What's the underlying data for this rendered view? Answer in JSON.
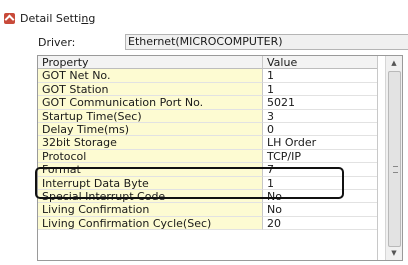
{
  "title": {
    "text_pre": "Detail Setti",
    "text_ul": "n",
    "text_post": "g"
  },
  "driver": {
    "label": "Driver:",
    "value": "Ethernet(MICROCOMPUTER)"
  },
  "grid": {
    "header": {
      "property": "Property",
      "value": "Value"
    },
    "rows": [
      {
        "property": "GOT Net No.",
        "value": "1"
      },
      {
        "property": "GOT Station",
        "value": "1"
      },
      {
        "property": "GOT Communication Port No.",
        "value": "5021"
      },
      {
        "property": "Startup Time(Sec)",
        "value": "3"
      },
      {
        "property": "Delay Time(ms)",
        "value": "0"
      },
      {
        "property": "32bit Storage",
        "value": "LH Order"
      },
      {
        "property": "Protocol",
        "value": "TCP/IP"
      },
      {
        "property": "Format",
        "value": "7"
      },
      {
        "property": "Interrupt Data Byte",
        "value": "1"
      },
      {
        "property": "Special Interrupt Code",
        "value": "No"
      },
      {
        "property": "Living Confirmation",
        "value": "No"
      },
      {
        "property": "Living Confirmation Cycle(Sec)",
        "value": "20"
      }
    ]
  },
  "scrollbar": {
    "up_glyph": "▲",
    "down_glyph": "▼"
  },
  "icons": {
    "title": "settings-window-icon"
  }
}
